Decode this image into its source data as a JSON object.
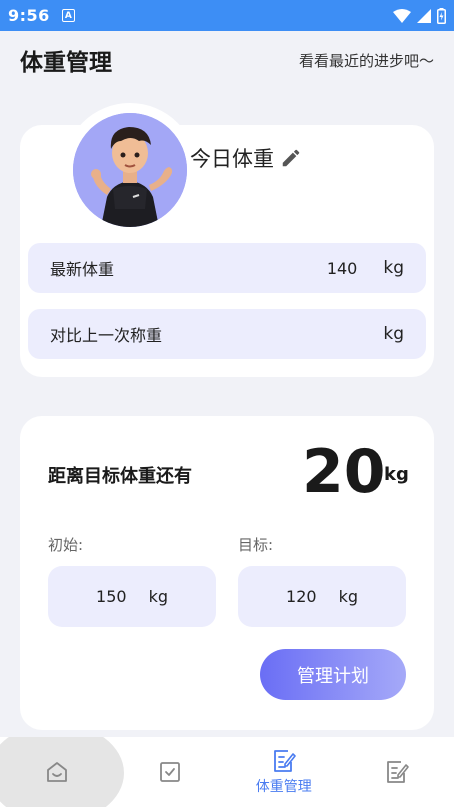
{
  "status": {
    "time": "9:56",
    "app_icon": "A"
  },
  "header": {
    "title": "体重管理",
    "tagline": "看看最近的进步吧～"
  },
  "today": {
    "label": "今日体重",
    "latest": {
      "label": "最新体重",
      "value": "140",
      "unit": "kg"
    },
    "compare": {
      "label": "对比上一次称重",
      "value": "",
      "unit": "kg"
    }
  },
  "goal": {
    "label": "距离目标体重还有",
    "remaining": "20",
    "unit": "kg",
    "start": {
      "label": "初始:",
      "value": "150",
      "unit": "kg"
    },
    "target": {
      "label": "目标:",
      "value": "120",
      "unit": "kg"
    },
    "manage_button": "管理计划"
  },
  "tabs": [
    {
      "icon": "home-icon",
      "label": ""
    },
    {
      "icon": "checkbox-icon",
      "label": ""
    },
    {
      "icon": "weight-edit-icon",
      "label": "体重管理",
      "active": true
    },
    {
      "icon": "note-edit-icon",
      "label": ""
    }
  ],
  "colors": {
    "status_bar": "#3d8ef5",
    "accent": "#5b6ff5",
    "row_bg": "#ecedfd",
    "active_tab": "#4a7cf0"
  }
}
